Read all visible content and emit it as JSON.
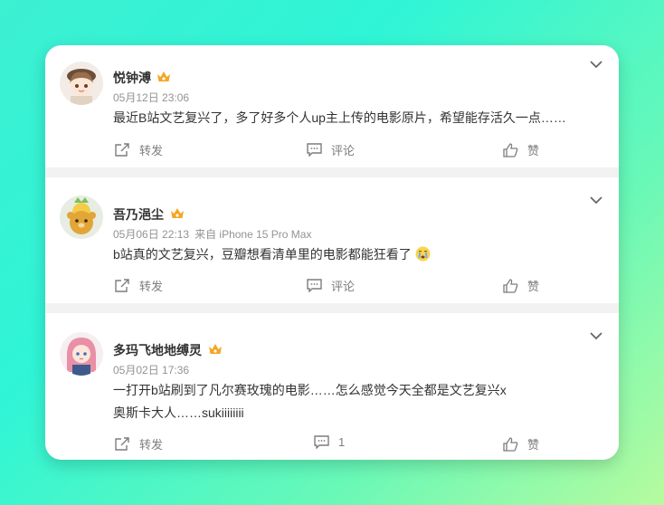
{
  "posts": [
    {
      "username": "悦钟溥",
      "meta": [
        "05月12日 23:06"
      ],
      "text": [
        "最近B站文艺复兴了，多了好多个人up主上传的电影原片，希望能存活久一点……"
      ],
      "repost_label": "转发",
      "comment_label": "评论",
      "like_label": "赞"
    },
    {
      "username": "吾乃浥尘",
      "meta": [
        "05月06日 22:13",
        "来自 iPhone 15 Pro Max"
      ],
      "text": [
        "b站真的文艺复兴，豆瓣想看清单里的电影都能狂看了"
      ],
      "repost_label": "转发",
      "comment_label": "评论",
      "like_label": "赞"
    },
    {
      "username": "多玛飞地地缚灵",
      "meta": [
        "05月02日 17:36"
      ],
      "text": [
        "一打开b站刷到了凡尔赛玫瑰的电影……怎么感觉今天全都是文艺复兴x",
        "奥斯卡大人……sukiiiiiiii"
      ],
      "repost_label": "转发",
      "comment_label": "1",
      "like_label": "赞"
    }
  ],
  "icons": {
    "crown": "vip-crown-icon",
    "chevron": "chevron-down-icon",
    "repost": "repost-icon",
    "comment": "comment-icon",
    "like": "like-icon",
    "emoji": "crying-face-emoji"
  },
  "colors": {
    "crown": "#f5a623",
    "text": "#333333",
    "meta": "#939393",
    "action": "#7d7d7d"
  }
}
